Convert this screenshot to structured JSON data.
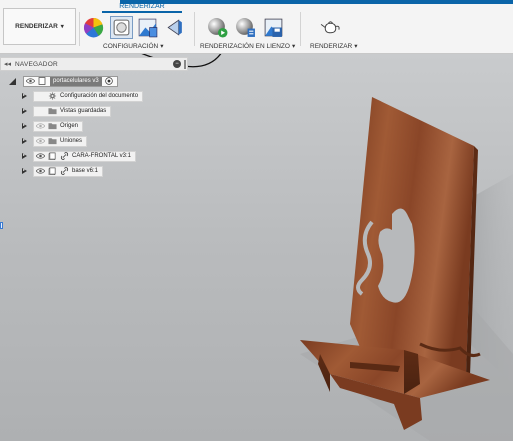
{
  "toolbar": {
    "tab_title": "RENDERIZAR",
    "workspace_button": "RENDERIZAR",
    "workspace_caret": "▾",
    "groups": [
      {
        "label": "CONFIGURACIÓN",
        "caret": "▾"
      },
      {
        "label": "RENDERIZACIÓN EN LIENZO",
        "caret": "▾"
      },
      {
        "label": "RENDERIZAR",
        "caret": "▾"
      }
    ],
    "icons": [
      "appearance-icon",
      "scene-settings-icon",
      "texture-map-icon",
      "decal-icon",
      "in-canvas-render-icon",
      "in-canvas-render-settings-icon",
      "capture-image-icon",
      "render-teapot-icon"
    ]
  },
  "navigator": {
    "title": "NAVEGADOR",
    "collapse_glyph": "◂◂",
    "items": [
      {
        "label": "portacelulares v3",
        "kind": "root"
      },
      {
        "label": "Configuración del documento",
        "kind": "settings"
      },
      {
        "label": "Vistas guardadas",
        "kind": "folder"
      },
      {
        "label": "Origen",
        "kind": "folder"
      },
      {
        "label": "Uniones",
        "kind": "folder"
      },
      {
        "label": "CARA-FRONTAL v3:1",
        "kind": "component"
      },
      {
        "label": "base v6:1",
        "kind": "component"
      }
    ]
  },
  "colors": {
    "accent": "#0a64a8",
    "wood": "#8a4a2a",
    "viewport": "#bcbec0"
  }
}
